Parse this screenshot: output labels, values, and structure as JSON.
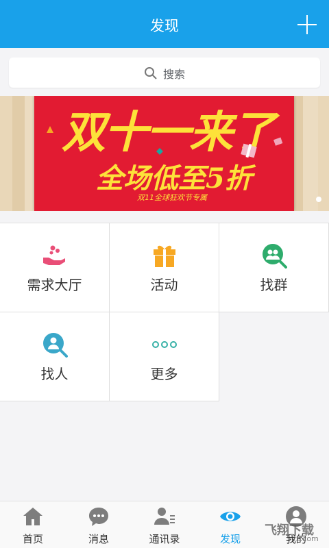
{
  "header": {
    "title": "发现"
  },
  "search": {
    "label": "搜索"
  },
  "banner": {
    "line1": "双十一来了",
    "line2": "全场低至5折",
    "line3": "双11全球狂欢节专属"
  },
  "grid": [
    {
      "label": "需求大厅",
      "icon": "hand-coins-icon"
    },
    {
      "label": "活动",
      "icon": "gift-icon"
    },
    {
      "label": "找群",
      "icon": "group-search-icon"
    },
    {
      "label": "找人",
      "icon": "person-search-icon"
    },
    {
      "label": "更多",
      "icon": "more-dots-icon"
    }
  ],
  "tabs": [
    {
      "label": "首页",
      "icon": "home-icon"
    },
    {
      "label": "消息",
      "icon": "message-icon"
    },
    {
      "label": "通讯录",
      "icon": "contacts-icon"
    },
    {
      "label": "发现",
      "icon": "eye-icon",
      "active": true
    },
    {
      "label": "我的",
      "icon": "profile-icon"
    }
  ],
  "watermark": {
    "text": "飞翔下载",
    "sub": "52z.com"
  },
  "colors": {
    "accent": "#19a1ea",
    "banner": "#e21b32",
    "gift": "#f7a823",
    "green": "#2eac6c",
    "teal": "#3aa7c9"
  }
}
